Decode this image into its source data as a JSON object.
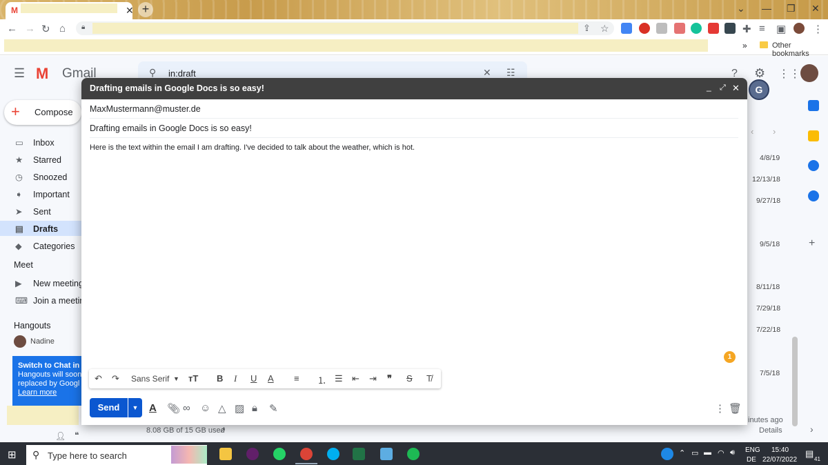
{
  "browser": {
    "other_bookmarks": "Other bookmarks",
    "more_chevron": "»"
  },
  "gmail": {
    "logo_text": "Gmail",
    "search_value": "in:draft",
    "compose_label": "Compose",
    "nav": [
      "Inbox",
      "Starred",
      "Snoozed",
      "Important",
      "Sent",
      "Drafts",
      "Categories"
    ],
    "meet_heading": "Meet",
    "meet_items": [
      "New meeting",
      "Join a meetin"
    ],
    "hangouts_heading": "Hangouts",
    "hangouts_user": "Nadine",
    "hangouts_banner_title": "Switch to Chat in",
    "hangouts_banner_lines": [
      "Hangouts will soon be",
      "replaced by Googl"
    ],
    "hangouts_learn_more": "Learn more",
    "dates": [
      "4/8/19",
      "12/13/18",
      "9/27/18",
      "9/5/18",
      "8/11/18",
      "7/29/18",
      "7/22/18",
      "7/5/18"
    ],
    "storage": "8.08 GB of 15 GB used",
    "last_activity": "inutes ago",
    "details": "Details"
  },
  "compose": {
    "title": "Drafting emails in Google Docs is so easy!",
    "to": "MaxMustermann@muster.de",
    "subject": "Drafting emails in Google Docs is so easy!",
    "body": "Here is the text within the email I am drafting. I've decided to talk about the weather, which is hot.",
    "font": "Sans Serif",
    "send": "Send",
    "grammarly_count": "1"
  },
  "taskbar": {
    "search_placeholder": "Type here to search",
    "lang_top": "ENG",
    "lang_bottom": "DE",
    "time": "15:40",
    "date": "22/07/2022",
    "notification_count": "41"
  },
  "colors": {
    "accent": "#1a73e8",
    "compose_header": "#404040",
    "gmail_red": "#ea4335"
  }
}
